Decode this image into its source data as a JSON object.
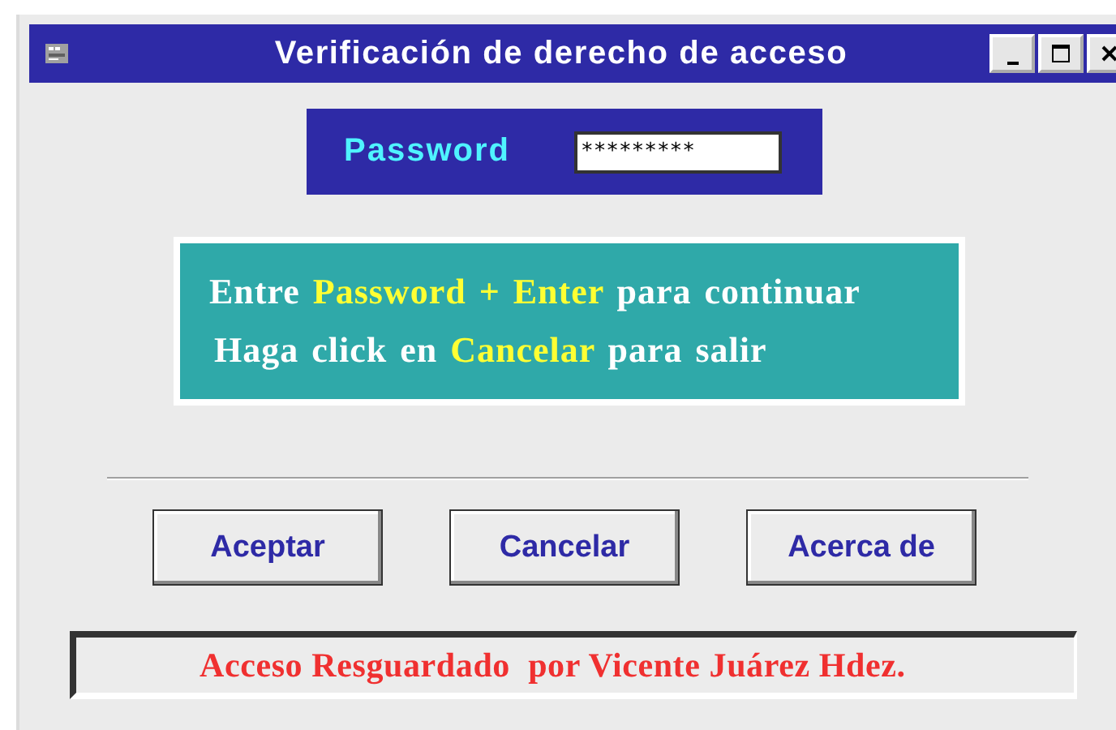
{
  "window": {
    "title": "Verificación de derecho de acceso"
  },
  "password": {
    "label": "Password",
    "value": "*********"
  },
  "instructions": [
    [
      {
        "text": "Entre ",
        "kind": "plain"
      },
      {
        "text": "Password + Enter",
        "kind": "highlight"
      },
      {
        "text": " para continuar",
        "kind": "plain"
      }
    ],
    [
      {
        "text": "Haga click en ",
        "kind": "plain"
      },
      {
        "text": "Cancelar",
        "kind": "highlight"
      },
      {
        "text": " para salir",
        "kind": "plain"
      }
    ]
  ],
  "buttons": [
    "Aceptar",
    "Cancelar",
    "Acerca de"
  ],
  "status_bar": "Acceso Resguardado  por Vicente Juárez Hdez."
}
